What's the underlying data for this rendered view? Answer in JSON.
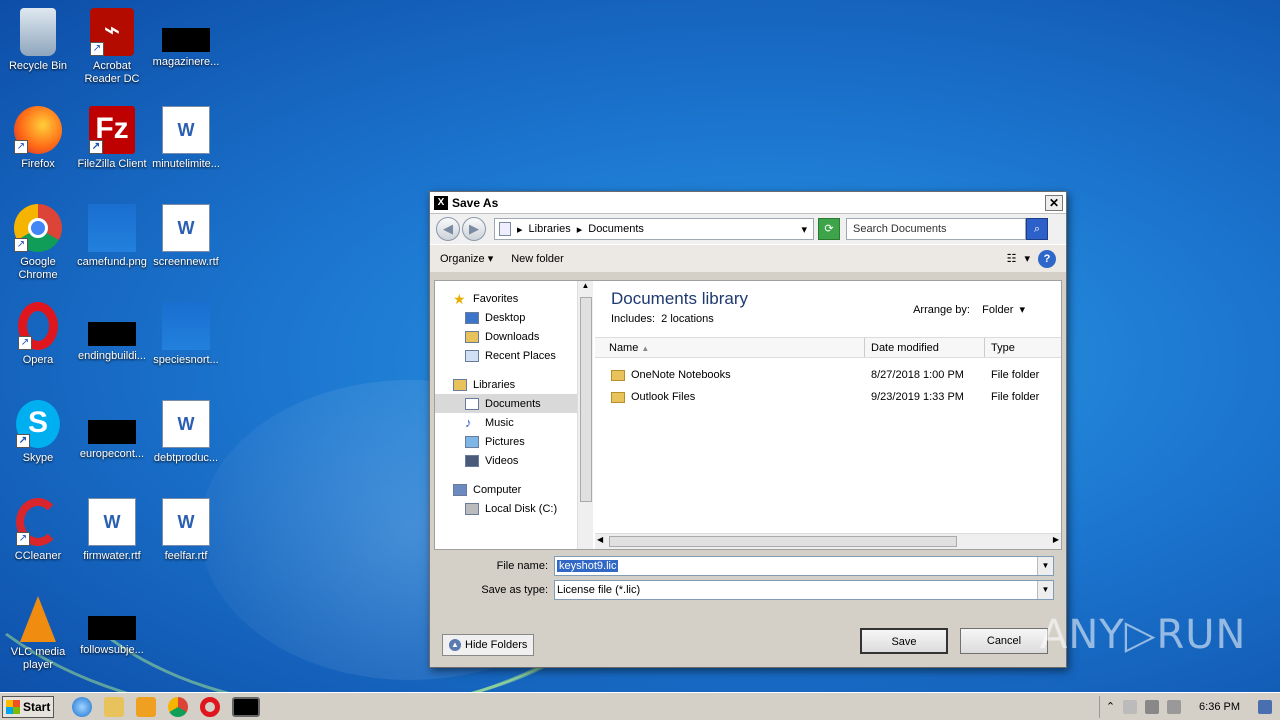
{
  "desktop": {
    "icons": [
      {
        "label": "Recycle Bin"
      },
      {
        "label": "Acrobat Reader DC"
      },
      {
        "label": "magazinere..."
      },
      {
        "label": "Firefox"
      },
      {
        "label": "FileZilla Client"
      },
      {
        "label": "minutelimite..."
      },
      {
        "label": "Google Chrome"
      },
      {
        "label": "camefund.png"
      },
      {
        "label": "screennew.rtf"
      },
      {
        "label": "Opera"
      },
      {
        "label": "endingbuildi..."
      },
      {
        "label": "speciesnort..."
      },
      {
        "label": "Skype"
      },
      {
        "label": "europecont..."
      },
      {
        "label": "debtproduc..."
      },
      {
        "label": "CCleaner"
      },
      {
        "label": "firmwater.rtf"
      },
      {
        "label": "feelfar.rtf"
      },
      {
        "label": "VLC media player"
      },
      {
        "label": "followsubje..."
      }
    ]
  },
  "dialog": {
    "title": "Save As",
    "close_label": "✕",
    "address": {
      "crumbs": [
        "Libraries",
        "Documents"
      ]
    },
    "search": {
      "placeholder": "Search Documents"
    },
    "toolbar": {
      "organize": "Organize",
      "new_folder": "New folder"
    },
    "nav": {
      "favorites": "Favorites",
      "desktop": "Desktop",
      "downloads": "Downloads",
      "recent": "Recent Places",
      "libraries": "Libraries",
      "documents": "Documents",
      "music": "Music",
      "pictures": "Pictures",
      "videos": "Videos",
      "computer": "Computer",
      "local_disk": "Local Disk (C:)"
    },
    "library": {
      "title": "Documents library",
      "includes_label": "Includes:",
      "includes_value": "2 locations",
      "arrange_label": "Arrange by:",
      "arrange_value": "Folder"
    },
    "columns": {
      "name": "Name",
      "date": "Date modified",
      "type": "Type"
    },
    "rows": [
      {
        "name": "OneNote Notebooks",
        "date": "8/27/2018 1:00 PM",
        "type": "File folder"
      },
      {
        "name": "Outlook Files",
        "date": "9/23/2019 1:33 PM",
        "type": "File folder"
      }
    ],
    "file_name_label": "File name:",
    "file_name_value": "keyshot9.lic",
    "save_type_label": "Save as type:",
    "save_type_value": "License file (*.lic)",
    "hide_folders": "Hide Folders",
    "save": "Save",
    "cancel": "Cancel"
  },
  "watermark": "ANY▷RUN",
  "taskbar": {
    "start": "Start",
    "clock": "6:36 PM"
  },
  "colors": {
    "accent": "#3168c6",
    "desktop": "#1c76cf"
  }
}
